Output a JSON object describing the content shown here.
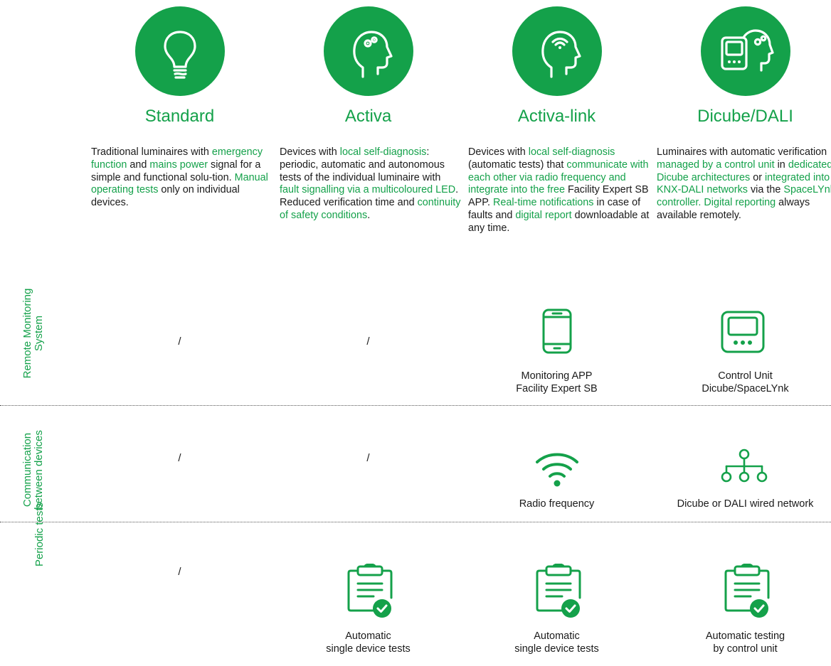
{
  "columns": [
    {
      "title": "Standard",
      "icon": "lightbulb-icon",
      "desc": [
        {
          "t": "Traditional luminaires with",
          "g": false
        },
        {
          "t": "emergency function",
          "g": true
        },
        {
          "t": "and",
          "g": false
        },
        {
          "t": "mains power",
          "g": true
        },
        {
          "t": "signal for a simple and functional solu-tion.",
          "g": false
        },
        {
          "t": "Manual operating tests",
          "g": true
        },
        {
          "t": "only on individual devices.",
          "g": false
        }
      ]
    },
    {
      "title": "Activa",
      "icon": "head-gears-icon",
      "desc": [
        {
          "t": "Devices with",
          "g": false
        },
        {
          "t": "local self-diagnosis",
          "g": true
        },
        {
          "t": ": periodic, automatic and autonomous tests of the individual luminaire with",
          "g": false
        },
        {
          "t": "fault signalling via a multicoloured LED",
          "g": true
        },
        {
          "t": ". Reduced verification time and",
          "g": false
        },
        {
          "t": "continuity of safety conditions",
          "g": true
        },
        {
          "t": ".",
          "g": false
        }
      ]
    },
    {
      "title": "Activa-link",
      "icon": "head-wifi-icon",
      "desc": [
        {
          "t": "Devices with",
          "g": false
        },
        {
          "t": "local self-diagnosis",
          "g": true
        },
        {
          "t": "(automatic tests) that",
          "g": false
        },
        {
          "t": "communicate with each other via radio frequency and integrate into the free",
          "g": true
        },
        {
          "t": "Facility Expert SB APP.",
          "g": false
        },
        {
          "t": "Real-time notifications",
          "g": true
        },
        {
          "t": "in case of faults and",
          "g": false
        },
        {
          "t": "digital report",
          "g": true
        },
        {
          "t": "downloadable at any time.",
          "g": false
        }
      ]
    },
    {
      "title": "Dicube/DALI",
      "icon": "control-unit-head-icon",
      "desc": [
        {
          "t": "Luminaires with automatic verification",
          "g": false
        },
        {
          "t": "managed by a control unit",
          "g": true
        },
        {
          "t": "in",
          "g": false
        },
        {
          "t": "dedicated Dicube architectures",
          "g": true
        },
        {
          "t": "or",
          "g": false
        },
        {
          "t": "integrated into KNX-DALI networks",
          "g": true
        },
        {
          "t": "via the",
          "g": false
        },
        {
          "t": "SpaceLYnk controller. Digital reporting",
          "g": true
        },
        {
          "t": "always available remotely.",
          "g": false
        }
      ]
    }
  ],
  "rows": {
    "remote": {
      "label": "Remote Monitoring System",
      "standard": "/",
      "activa": "/",
      "activa_link_line1": "Monitoring APP",
      "activa_link_line2": "Facility Expert SB",
      "dicube_line1": "Control Unit",
      "dicube_line2": "Dicube/SpaceLYnk"
    },
    "communication": {
      "label": "Communication between devices",
      "standard": "/",
      "activa": "/",
      "activa_link": "Radio frequency",
      "dicube": "Dicube or DALI wired network"
    },
    "periodic": {
      "label": "Periodic tests",
      "standard": "/",
      "activa_line1": "Automatic",
      "activa_line2": "single device tests",
      "activa_link_line1": "Automatic",
      "activa_link_line2": "single device tests",
      "dicube_line1": "Automatic testing",
      "dicube_line2": "by control unit"
    }
  },
  "colors": {
    "accent": "#14a14a",
    "text": "#1a1a1a"
  }
}
